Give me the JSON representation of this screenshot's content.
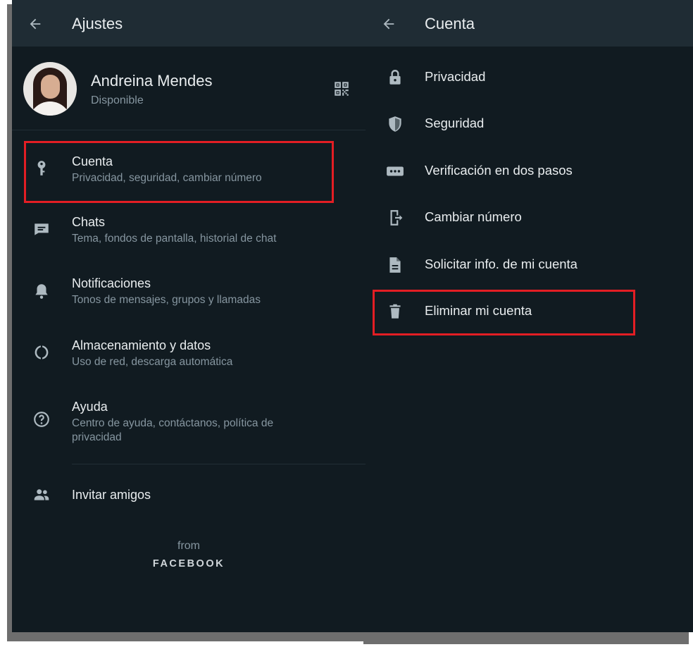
{
  "left_screen": {
    "title": "Ajustes",
    "profile": {
      "name": "Andreina Mendes",
      "status": "Disponible"
    },
    "items": [
      {
        "title": "Cuenta",
        "subtitle": "Privacidad, seguridad, cambiar número",
        "icon": "key-icon"
      },
      {
        "title": "Chats",
        "subtitle": "Tema, fondos de pantalla, historial de chat",
        "icon": "chat-icon"
      },
      {
        "title": "Notificaciones",
        "subtitle": "Tonos de mensajes, grupos y llamadas",
        "icon": "bell-icon"
      },
      {
        "title": "Almacenamiento y datos",
        "subtitle": "Uso de red, descarga automática",
        "icon": "storage-icon"
      },
      {
        "title": "Ayuda",
        "subtitle": "Centro de ayuda, contáctanos, política de privacidad",
        "icon": "help-icon"
      }
    ],
    "invite": "Invitar amigos",
    "footer": {
      "from": "from",
      "brand": "FACEBOOK"
    }
  },
  "right_screen": {
    "title": "Cuenta",
    "items": [
      {
        "label": "Privacidad",
        "icon": "lock-icon"
      },
      {
        "label": "Seguridad",
        "icon": "shield-icon"
      },
      {
        "label": "Verificación en dos pasos",
        "icon": "password-dots-icon"
      },
      {
        "label": "Cambiar número",
        "icon": "phone-change-icon"
      },
      {
        "label": "Solicitar info. de mi cuenta",
        "icon": "document-icon"
      },
      {
        "label": "Eliminar mi cuenta",
        "icon": "trash-icon"
      }
    ]
  },
  "colors": {
    "background": "#111b21",
    "appbar": "#1f2c34",
    "text_primary": "#e9edef",
    "text_secondary": "#8696a0",
    "icon": "#aebac1",
    "highlight": "#e31e24"
  }
}
